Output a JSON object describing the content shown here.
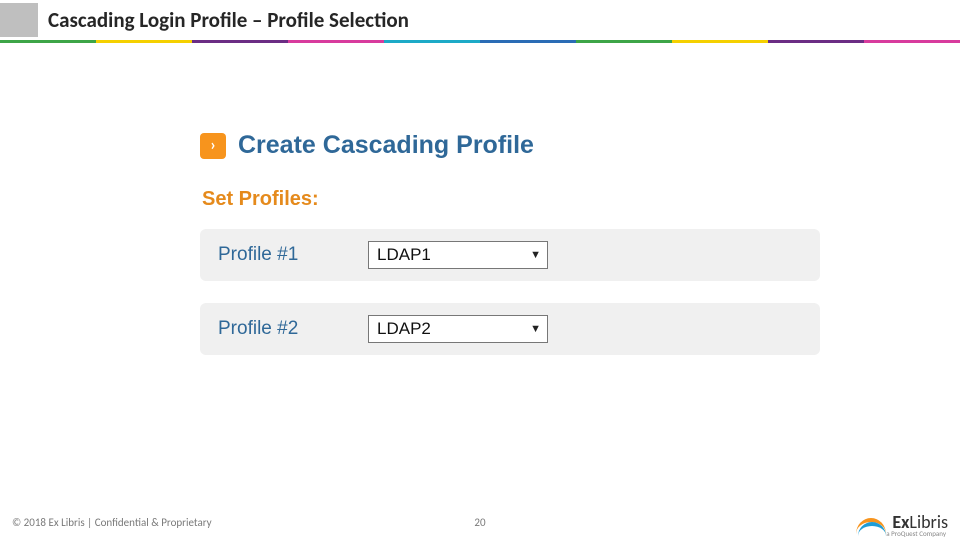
{
  "header": {
    "title": "Cascading Login Profile – Profile Selection"
  },
  "section": {
    "chevron": "›",
    "heading": "Create Cascading Profile",
    "subheading": "Set Profiles:"
  },
  "profiles": [
    {
      "label": "Profile #1",
      "value": "LDAP1"
    },
    {
      "label": "Profile #2",
      "value": "LDAP2"
    }
  ],
  "footer": {
    "copyright": "© 2018 Ex Libris | Confidential & Proprietary",
    "page": "20",
    "brand_part1": "Ex",
    "brand_part2": "Libris",
    "brand_sub": "a ProQuest Company"
  }
}
